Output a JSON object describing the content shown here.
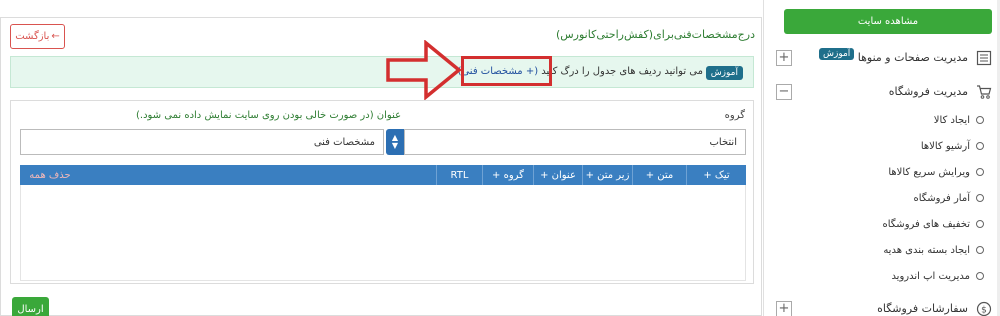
{
  "main": {
    "page_title": "درج‌مشخصات‌فنی‌برای(کفش‌راحتی‌کانورس)",
    "back_label": "بازگشت",
    "hint": {
      "badge": "آموزش",
      "message": "می توانید ردیف های جدول را درگ کنید",
      "link": "(+ مشخصات فنی)"
    },
    "form": {
      "group_label": "گروه",
      "title_label": "عنوان (در صورت خالی بودن روی سایت نمایش داده نمی شود.)",
      "select_value": "انتخاب",
      "title_value": "مشخصات فنی",
      "columns": [
        "+ تیک",
        "+ متن",
        "+ زیر متن",
        "+ عنوان",
        "+ گروه",
        "RTL"
      ],
      "delete_all": "حذف همه"
    },
    "send_label": "ارسال"
  },
  "sidebar": {
    "view_site": "مشاهده سایت",
    "pages_menu": "مدیریت صفحات و منوها",
    "teach_badge": "آموزش",
    "store_mgmt": "مدیریت فروشگاه",
    "store_items": [
      "ایجاد کالا",
      "آرشیو کالاها",
      "ویرایش سریع کالاها",
      "آمار فروشگاه",
      "تخفیف های فروشگاه",
      "ایجاد بسته بندی هدیه",
      "مدیریت اپ اندروید"
    ],
    "orders": "سفارشات فروشگاه"
  },
  "colors": {
    "green": "#3aa83a",
    "blue": "#3a7fc1",
    "red": "#d32f2f",
    "teal": "#1f6f8b"
  }
}
